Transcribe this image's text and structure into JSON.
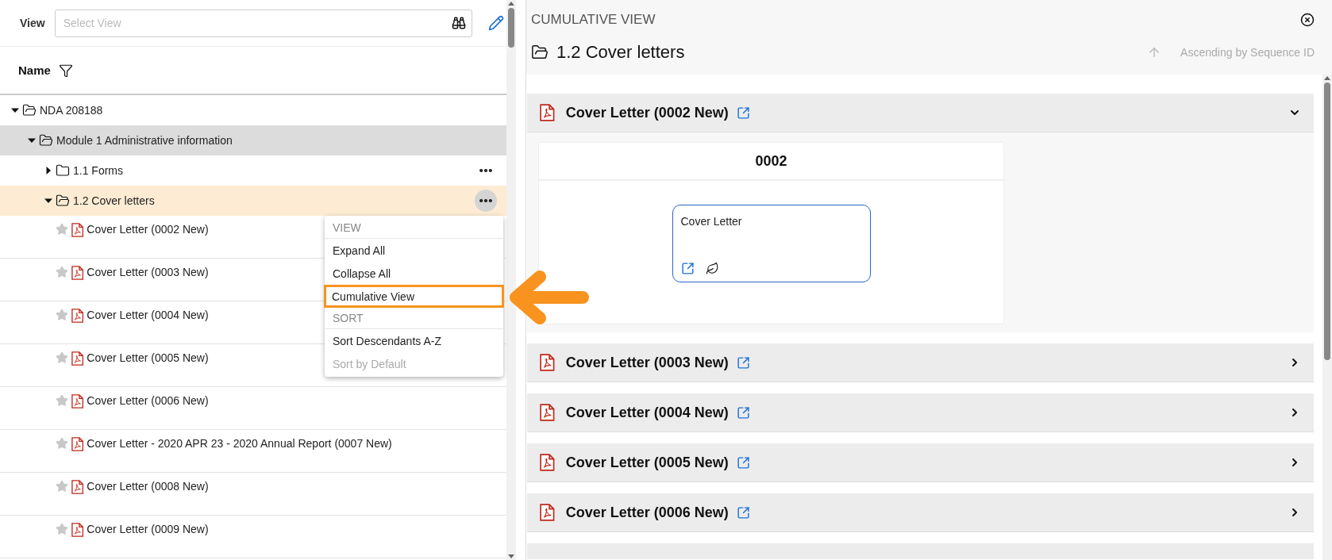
{
  "view_bar": {
    "label": "View",
    "placeholder": "Select View"
  },
  "column_header": {
    "label": "Name"
  },
  "tree": [
    {
      "kind": "folder",
      "label": "NDA 208188",
      "expanded": true,
      "selected": false,
      "shaded": false,
      "has_menu": false,
      "children": [
        {
          "kind": "folder",
          "label": "Module 1 Administrative information",
          "expanded": true,
          "selected": false,
          "shaded": true,
          "has_menu": false,
          "children": [
            {
              "kind": "folder",
              "label": "1.1 Forms",
              "expanded": false,
              "selected": false,
              "shaded": false,
              "has_menu": true,
              "menu_open": false
            },
            {
              "kind": "folder",
              "label": "1.2 Cover letters",
              "expanded": true,
              "selected": true,
              "shaded": false,
              "has_menu": true,
              "menu_open": true,
              "children": [
                {
                  "kind": "document",
                  "label": "Cover Letter (0002 New)",
                  "starred": false
                },
                {
                  "kind": "document",
                  "label": "Cover Letter (0003 New)",
                  "starred": false
                },
                {
                  "kind": "document",
                  "label": "Cover Letter (0004 New)",
                  "starred": false
                },
                {
                  "kind": "document",
                  "label": "Cover Letter (0005 New)",
                  "starred": false
                },
                {
                  "kind": "document",
                  "label": "Cover Letter (0006 New)",
                  "starred": false
                },
                {
                  "kind": "document",
                  "label": "Cover Letter - 2020 APR 23 - 2020 Annual Report (0007 New)",
                  "starred": false
                },
                {
                  "kind": "document",
                  "label": "Cover Letter (0008 New)",
                  "starred": false
                },
                {
                  "kind": "document",
                  "label": "Cover Letter (0009 New)",
                  "starred": false
                }
              ]
            }
          ]
        }
      ]
    }
  ],
  "context_menu": [
    {
      "kind": "header",
      "label": "VIEW"
    },
    {
      "kind": "item",
      "label": "Expand All",
      "disabled": false,
      "highlighted": false
    },
    {
      "kind": "item",
      "label": "Collapse All",
      "disabled": false,
      "highlighted": false
    },
    {
      "kind": "item",
      "label": "Cumulative View",
      "disabled": false,
      "highlighted": true
    },
    {
      "kind": "header",
      "label": "SORT"
    },
    {
      "kind": "item",
      "label": "Sort Descendants A-Z",
      "disabled": false,
      "highlighted": false
    },
    {
      "kind": "item",
      "label": "Sort by Default",
      "disabled": true,
      "highlighted": false
    }
  ],
  "cumulative_view": {
    "title": "CUMULATIVE VIEW",
    "folder": "1.2 Cover letters",
    "sort_label": "Ascending by Sequence ID",
    "sections": [
      {
        "title": "Cover Letter (0002 New)",
        "expanded": true,
        "sequences": [
          {
            "id": "0002",
            "documents": [
              {
                "title": "Cover Letter"
              }
            ]
          }
        ]
      },
      {
        "title": "Cover Letter (0003 New)",
        "expanded": false
      },
      {
        "title": "Cover Letter (0004 New)",
        "expanded": false
      },
      {
        "title": "Cover Letter (0005 New)",
        "expanded": false
      },
      {
        "title": "Cover Letter (0006 New)",
        "expanded": false
      }
    ]
  }
}
